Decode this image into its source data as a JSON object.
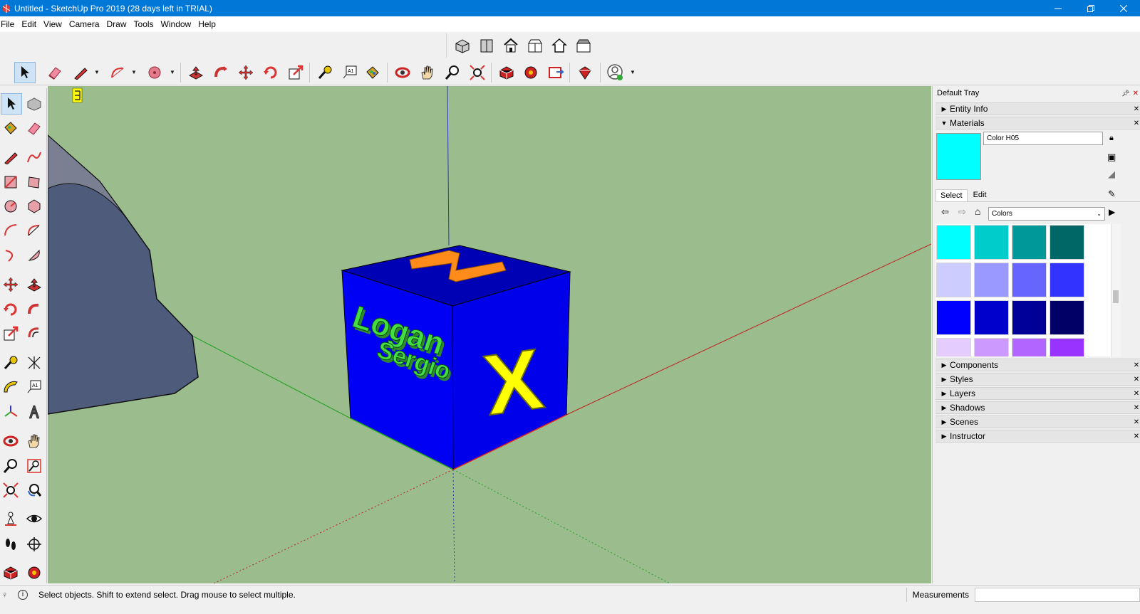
{
  "window": {
    "title": "Untitled - SketchUp Pro 2019 (28 days left in TRIAL)",
    "icons": {
      "minimize": "minimize-icon",
      "restore": "restore-icon",
      "close": "close-icon"
    }
  },
  "menubar": {
    "items": [
      "File",
      "Edit",
      "View",
      "Camera",
      "Draw",
      "Tools",
      "Window",
      "Help"
    ]
  },
  "views_toolbar": {
    "icons": [
      "iso-view-icon",
      "top-view-icon",
      "front-view-icon",
      "right-view-icon",
      "back-view-icon",
      "left-view-icon"
    ]
  },
  "main_toolbar": {
    "icons": [
      "select-icon",
      "eraser-icon",
      "line-icon",
      "arc-icon",
      "shapes-icon",
      "push-pull-icon",
      "offset-icon",
      "move-icon",
      "rotate-icon",
      "scale-icon",
      "tape-measure-icon",
      "text-icon",
      "paint-bucket-icon",
      "orbit-icon",
      "pan-icon",
      "zoom-icon",
      "zoom-extents-icon",
      "3d-warehouse-icon",
      "extension-warehouse-icon",
      "layout-icon",
      "extension-manager-icon",
      "account-icon"
    ]
  },
  "left_toolbar": {
    "icons": [
      "select-icon",
      "make-component-icon",
      "paint-bucket-icon",
      "eraser-icon",
      "pencil-icon",
      "freehand-icon",
      "rectangle-icon",
      "rotated-rectangle-icon",
      "circle-icon",
      "polygon-icon",
      "arc-icon",
      "two-point-arc-icon",
      "three-point-arc-icon",
      "pie-icon",
      "move-icon",
      "push-pull-icon",
      "rotate-icon",
      "follow-me-icon",
      "scale-icon",
      "offset-icon",
      "tape-measure-icon",
      "dimension-icon",
      "protractor-icon",
      "text-icon",
      "axes-icon",
      "3d-text-icon",
      "orbit-icon",
      "pan-icon",
      "zoom-icon",
      "zoom-window-icon",
      "zoom-extents-icon",
      "previous-view-icon",
      "position-camera-icon",
      "look-around-icon",
      "walk-icon",
      "section-plane-icon",
      "3d-warehouse-icon",
      "extension-warehouse-icon"
    ]
  },
  "viewport": {
    "background": "#9bbd8e",
    "scene_text": {
      "front_text_1": "Logan",
      "front_text_2": "Sergio",
      "side_letter": "X"
    },
    "colors": {
      "cube_face": "#0000ff",
      "text_green": "#33cc33",
      "text_yellow": "#ffff00",
      "text_orange": "#ff8c1a",
      "mountain": "#4f5b7b"
    }
  },
  "tray": {
    "title": "Default Tray",
    "panels": {
      "entity_info": "Entity Info",
      "materials": "Materials"
    },
    "materials": {
      "material_name": "Color H05",
      "preview_color": "#00ffff",
      "tabs": [
        "Select",
        "Edit"
      ],
      "library": "Colors",
      "swatches": [
        "#00ffff",
        "#00cccc",
        "#009999",
        "#006666",
        "#ccccff",
        "#9999ff",
        "#6666ff",
        "#3333ff",
        "#0000ff",
        "#0000cc",
        "#000099",
        "#000066",
        "#e5ccff",
        "#cc99ff",
        "#b266ff",
        "#9933ff"
      ]
    },
    "collapsed_panels": [
      "Components",
      "Styles",
      "Layers",
      "Shadows",
      "Scenes",
      "Instructor"
    ]
  },
  "statusbar": {
    "message": "Select objects. Shift to extend select. Drag mouse to select multiple.",
    "measurements_label": "Measurements",
    "measurements_value": ""
  }
}
